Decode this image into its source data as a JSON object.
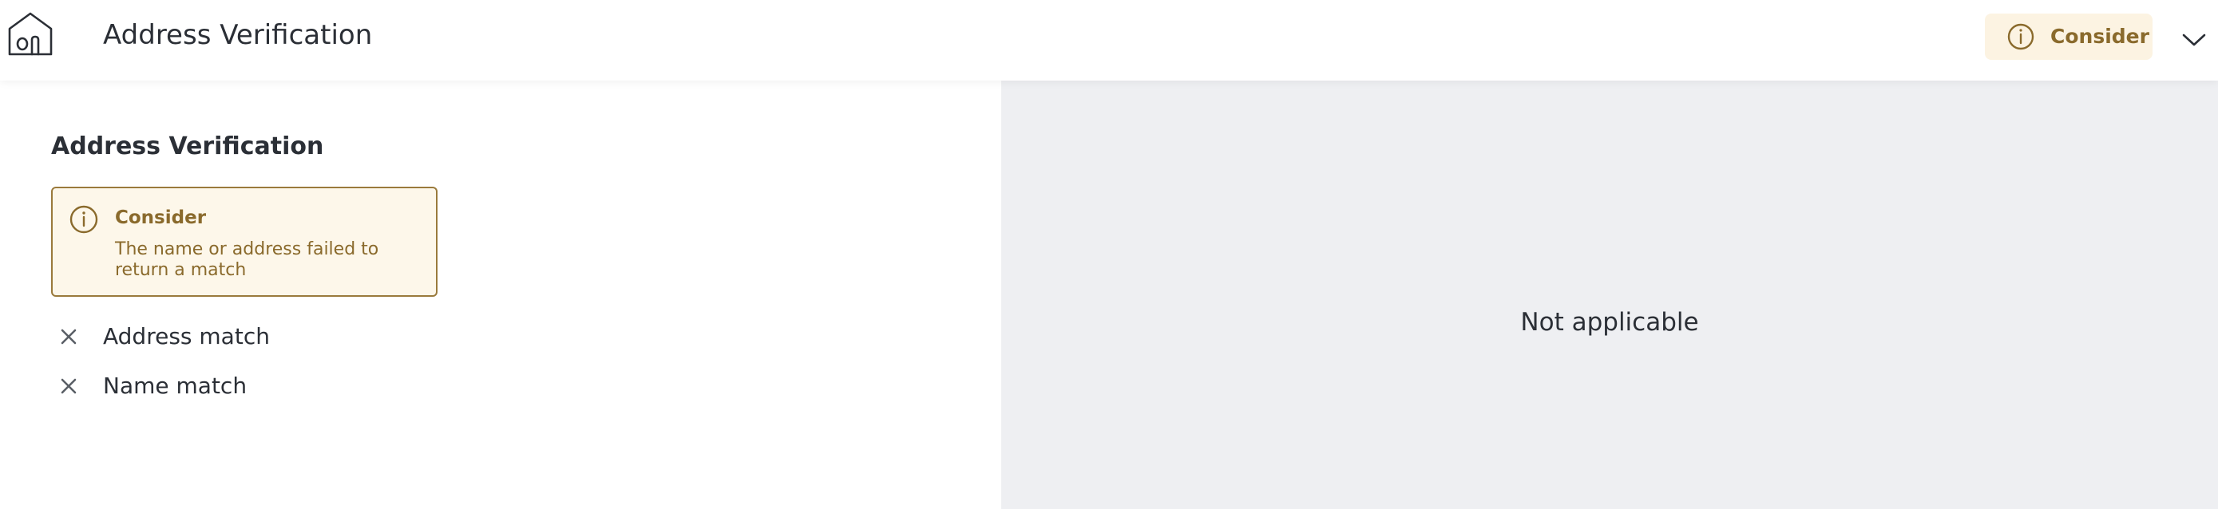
{
  "header": {
    "logo_icon": "house-logo-icon",
    "title": "Address Verification",
    "status": {
      "label": "Consider",
      "icon": "info-circle-icon",
      "background": "#fcf3e2",
      "text_color": "#8a6a2c"
    },
    "expand_icon": "chevron-down-icon"
  },
  "main": {
    "section_title": "Address Verification",
    "alert": {
      "icon": "info-circle-icon",
      "title": "Consider",
      "message": "The name or address failed to return a match",
      "border_color": "#9a7a3c",
      "background": "#fdf7ea"
    },
    "checks": [
      {
        "label": "Address match",
        "icon": "x-icon",
        "passed": false
      },
      {
        "label": "Name match",
        "icon": "x-icon",
        "passed": false
      }
    ]
  },
  "side_panel": {
    "message": "Not applicable",
    "background": "#eeeff2"
  }
}
